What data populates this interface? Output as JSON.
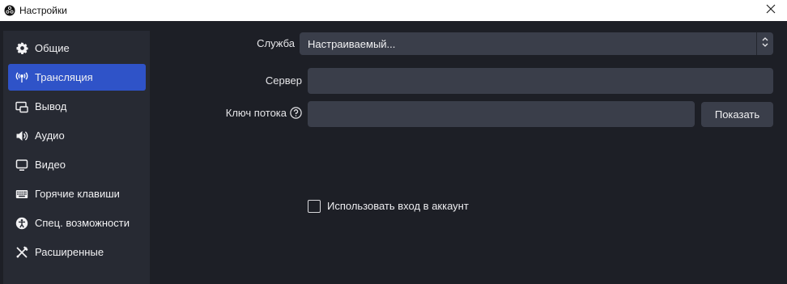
{
  "window": {
    "title": "Настройки",
    "app_icon": "obs-logo-icon",
    "close_icon": "close-icon"
  },
  "sidebar": {
    "items": [
      {
        "label": "Общие",
        "icon": "gear-icon",
        "active": false
      },
      {
        "label": "Трансляция",
        "icon": "antenna-icon",
        "active": true
      },
      {
        "label": "Вывод",
        "icon": "output-icon",
        "active": false
      },
      {
        "label": "Аудио",
        "icon": "speaker-icon",
        "active": false
      },
      {
        "label": "Видео",
        "icon": "monitor-icon",
        "active": false
      },
      {
        "label": "Горячие клавиши",
        "icon": "keyboard-icon",
        "active": false
      },
      {
        "label": "Спец. возможности",
        "icon": "accessibility-icon",
        "active": false
      },
      {
        "label": "Расширенные",
        "icon": "tools-icon",
        "active": false
      }
    ]
  },
  "stream": {
    "service_label": "Служба",
    "service_value": "Настраиваемый...",
    "server_label": "Сервер",
    "server_value": "",
    "key_label": "Ключ потока",
    "key_value": "",
    "show_button": "Показать",
    "account_checkbox_label": "Использовать вход в аккаунт",
    "account_checked": false
  },
  "colors": {
    "background": "#1d1f26",
    "sidebar": "#272a33",
    "accent": "#2f53c8",
    "input": "#3a3e4a"
  }
}
